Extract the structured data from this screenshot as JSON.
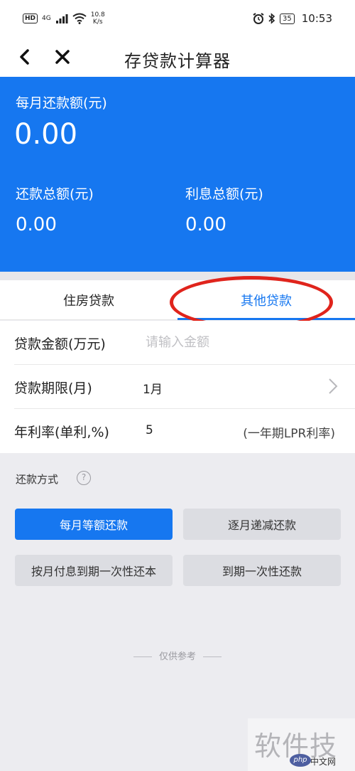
{
  "status_bar": {
    "hd_badge": "HD",
    "signal_label": "4G",
    "net_speed_value": "10.8",
    "net_speed_unit": "K/s",
    "battery": "35",
    "time": "10:53"
  },
  "nav": {
    "title": "存贷款计算器"
  },
  "summary": {
    "monthly_label": "每月还款额(元)",
    "monthly_value": "0.00",
    "total_label": "还款总额(元)",
    "total_value": "0.00",
    "interest_label": "利息总额(元)",
    "interest_value": "0.00"
  },
  "tabs": [
    {
      "label": "住房贷款",
      "active": false
    },
    {
      "label": "其他贷款",
      "active": true
    }
  ],
  "form": {
    "amount_label": "贷款金额(万元)",
    "amount_value": "",
    "amount_placeholder": "请输入金额",
    "term_label": "贷款期限(月)",
    "term_value": "1月",
    "rate_label": "年利率(单利,%)",
    "rate_value": "5",
    "rate_note": "(一年期LPR利率)"
  },
  "repay": {
    "label": "还款方式",
    "help_glyph": "?",
    "options": [
      {
        "label": "每月等额还款",
        "active": true
      },
      {
        "label": "逐月递减还款",
        "active": false
      },
      {
        "label": "按月付息到期一次性还本",
        "active": false
      },
      {
        "label": "到期一次性还款",
        "active": false
      }
    ]
  },
  "footer_note": "仅供参考",
  "watermark": {
    "text": "软件技巧",
    "logo": "php",
    "sub": "中文网"
  },
  "colors": {
    "primary": "#1677f0",
    "annotation": "#e0241c",
    "background": "#ececf0"
  }
}
